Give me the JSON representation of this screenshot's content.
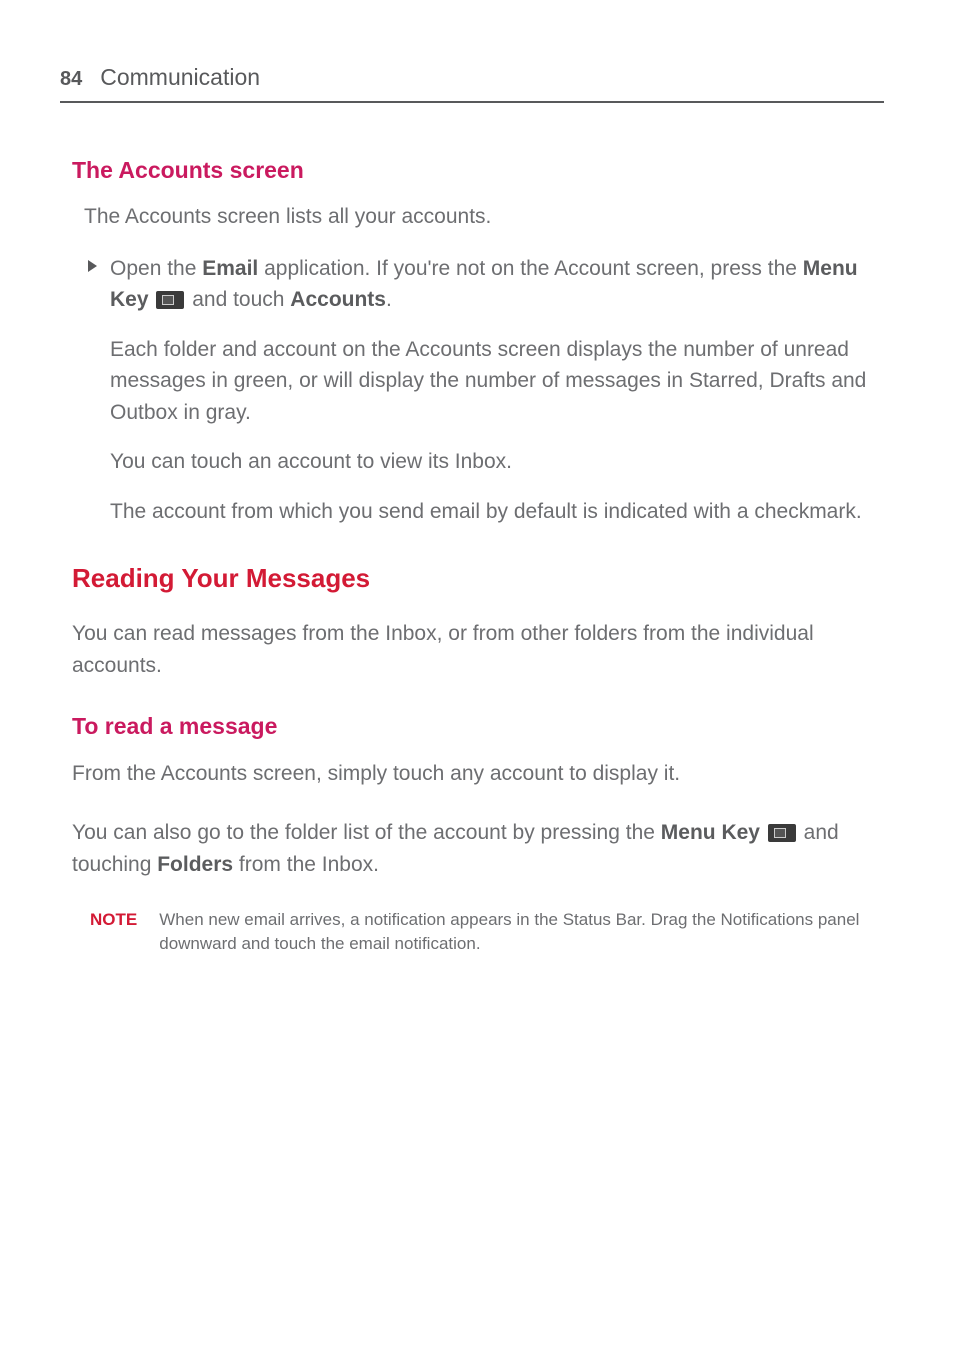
{
  "header": {
    "page_number": "84",
    "chapter": "Communication"
  },
  "sections": {
    "accounts_screen": {
      "heading": "The Accounts screen",
      "intro": "The Accounts screen lists all your accounts.",
      "bullet": {
        "open_1": "Open the ",
        "email_term": "Email",
        "open_2": " application. If you're not on the Account screen, press the ",
        "menu_key_term": "Menu Key",
        "open_3": " and touch ",
        "accounts_term": "Accounts",
        "open_4": ".",
        "para_folders": "Each folder and account on the Accounts screen displays the number of unread messages in green, or will display the number of messages in Starred, Drafts and Outbox in gray.",
        "para_touch": "You can touch an account to view its Inbox.",
        "para_default": "The account from which you send email by default is indicated with a checkmark."
      }
    },
    "reading": {
      "heading": "Reading Your Messages",
      "intro": "You can read messages from the Inbox, or from other folders from the individual accounts."
    },
    "to_read": {
      "heading": "To read a message",
      "p1": "From the Accounts screen, simply touch any account to display it.",
      "p2_a": "You can also go to the folder list of the account by pressing the ",
      "p2_menu": "Menu Key",
      "p2_b": " and touching ",
      "p2_folders": "Folders",
      "p2_c": " from the Inbox."
    },
    "note": {
      "label": "NOTE",
      "text": "When new email arrives, a notification appears in the Status Bar. Drag the Notifications panel downward and touch the email notification."
    }
  }
}
